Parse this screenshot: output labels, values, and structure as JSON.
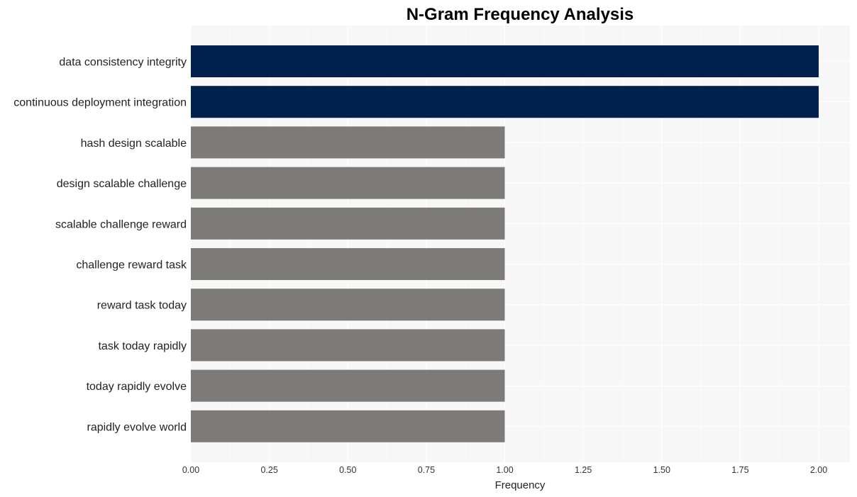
{
  "chart_data": {
    "type": "bar",
    "orientation": "horizontal",
    "title": "N-Gram Frequency Analysis",
    "xlabel": "Frequency",
    "ylabel": "",
    "xlim": [
      0,
      2.1
    ],
    "xticks": [
      "0.00",
      "0.25",
      "0.50",
      "0.75",
      "1.00",
      "1.25",
      "1.50",
      "1.75",
      "2.00"
    ],
    "xtick_values": [
      0,
      0.25,
      0.5,
      0.75,
      1.0,
      1.25,
      1.5,
      1.75,
      2.0
    ],
    "grid": true,
    "categories": [
      "data consistency integrity",
      "continuous deployment integration",
      "hash design scalable",
      "design scalable challenge",
      "scalable challenge reward",
      "challenge reward task",
      "reward task today",
      "task today rapidly",
      "today rapidly evolve",
      "rapidly evolve world"
    ],
    "values": [
      2,
      2,
      1,
      1,
      1,
      1,
      1,
      1,
      1,
      1
    ],
    "colors": {
      "highlight": "#00214d",
      "default": "#7d7b77",
      "panel_background": "#f7f7f7",
      "grid": "#ffffff"
    }
  }
}
